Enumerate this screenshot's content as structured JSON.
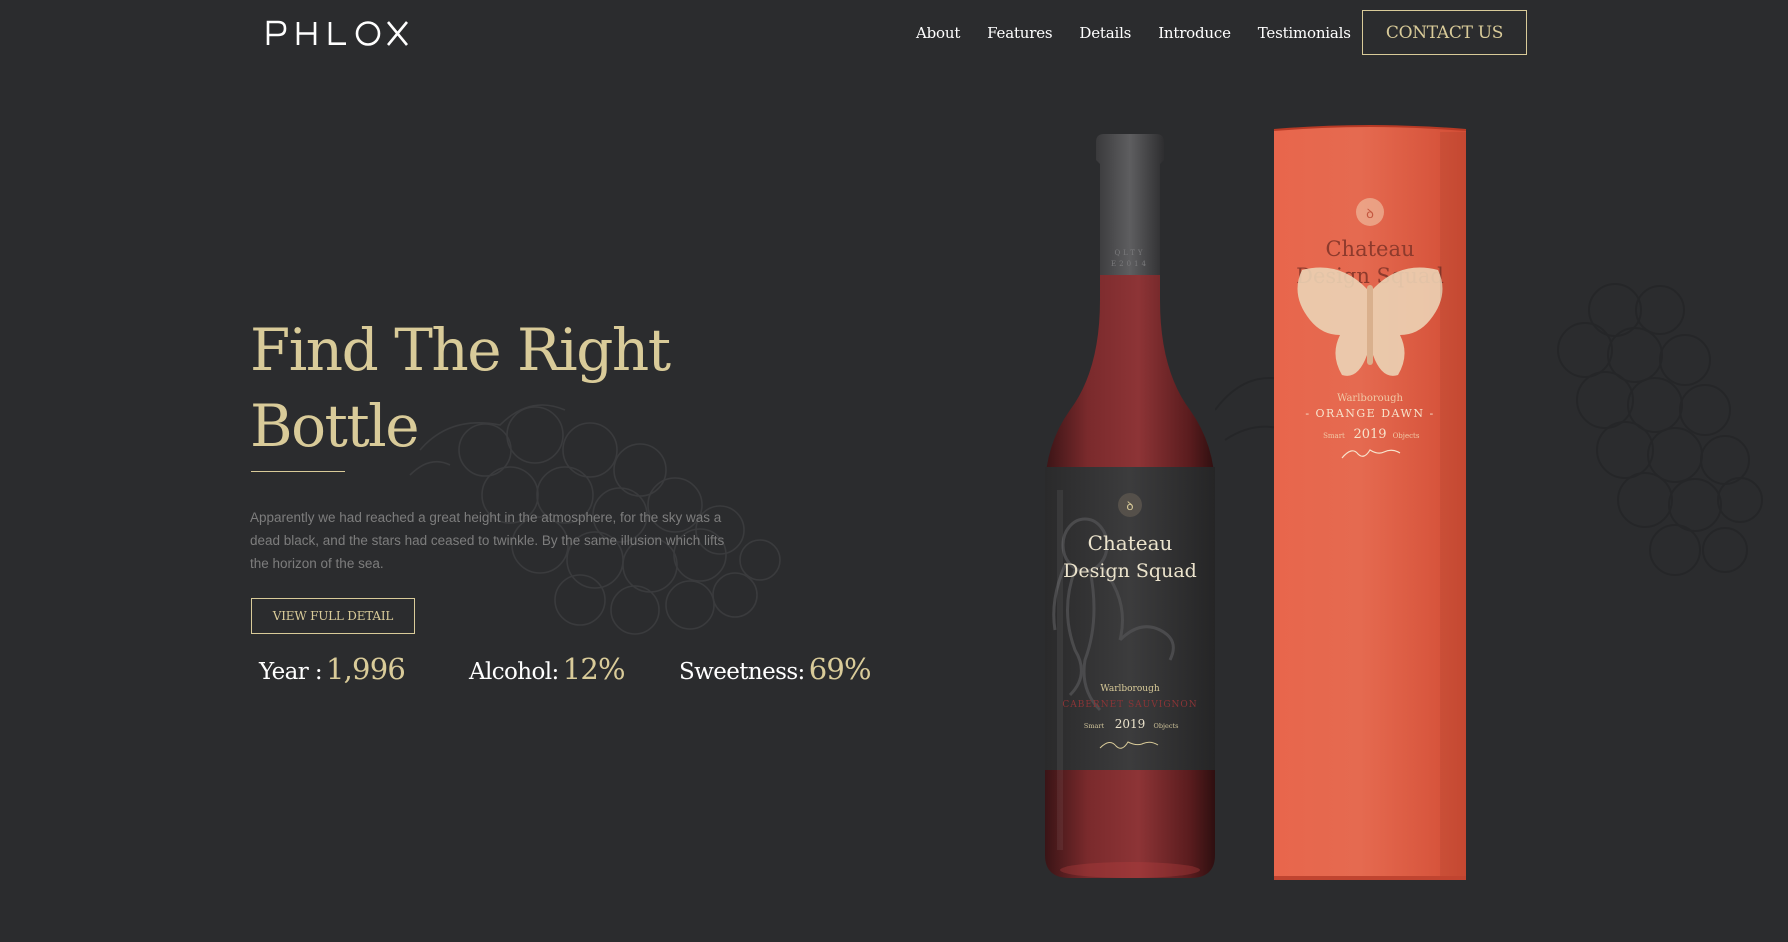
{
  "header": {
    "logo_text": "PHLOX",
    "nav": [
      "About",
      "Features",
      "Details",
      "Introduce",
      "Testimonials"
    ],
    "contact_label": "CONTACT US"
  },
  "hero": {
    "title_line1": "Find The Right",
    "title_line2": "Bottle",
    "description": "Apparently we had reached a great height in the atmosphere, for the sky was a dead black, and the stars had ceased to twinkle. By the same illusion which lifts the horizon of the sea.",
    "detail_label": "VIEW FULL DETAIL",
    "stats": {
      "year_label": "Year :",
      "year_value": "1,996",
      "alcohol_label": "Alcohol:",
      "alcohol_value": "12%",
      "sweetness_label": "Sweetness:",
      "sweetness_value": "69%"
    }
  },
  "bottle_label": {
    "brand_line1": "Chateau",
    "brand_line2": "Design Squad",
    "region": "Warlborough",
    "variety": "CABERNET SAUVIGNON",
    "left_word": "Smart",
    "year": "2019",
    "right_word": "Objects",
    "neck_line1": "QLTY",
    "neck_line2": "E2014"
  },
  "box_label": {
    "brand_line1": "Chateau",
    "brand_line2": "Design Squad",
    "region": "Warlborough",
    "variety": "- ORANGE DAWN -",
    "left_word": "Smart",
    "year": "2019",
    "right_word": "Objects"
  },
  "colors": {
    "background": "#2b2c2e",
    "accent_gold": "#d9cb99",
    "box_orange": "#e05a40",
    "wine": "#7a2a2a"
  }
}
